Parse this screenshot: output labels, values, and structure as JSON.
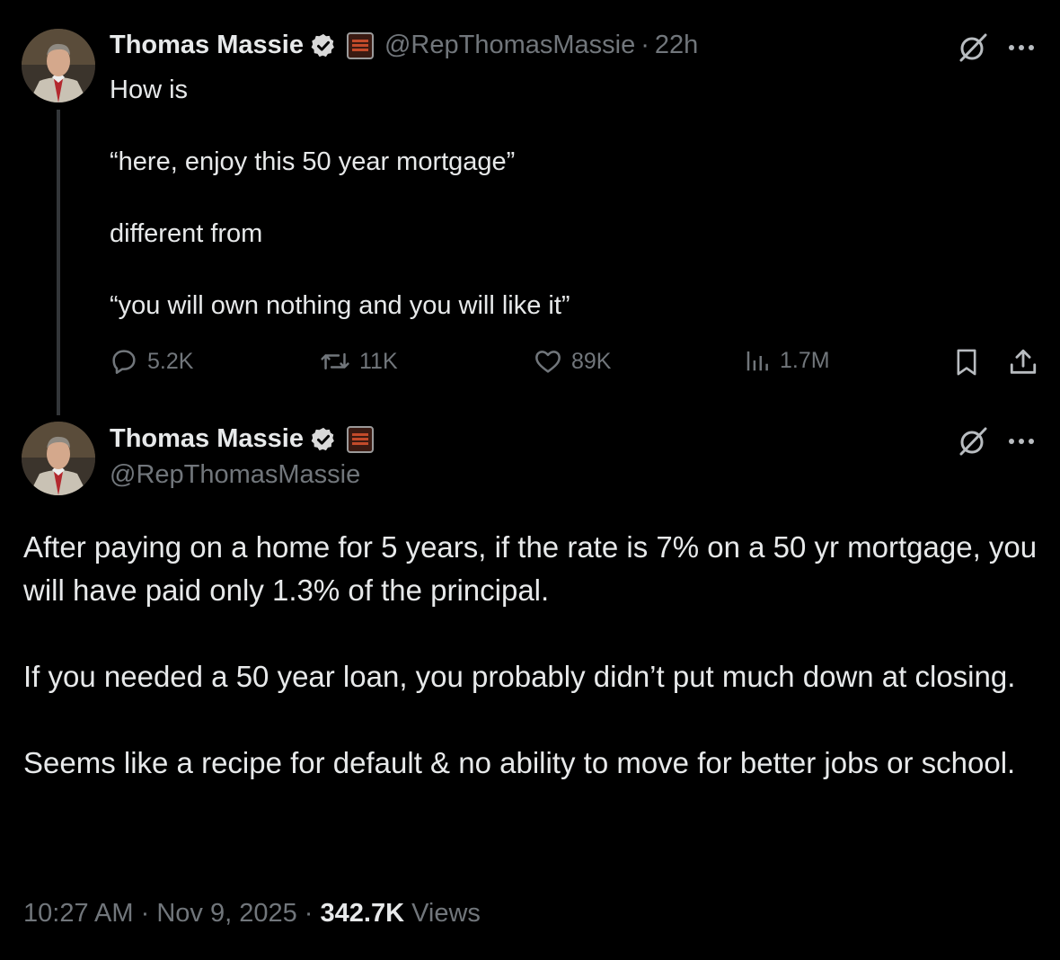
{
  "tweet1": {
    "author": "Thomas Massie",
    "handle": "@RepThomasMassie",
    "separator": "·",
    "time": "22h",
    "text": "How is\n\n“here, enjoy this 50 year mortgage”\n\ndifferent from\n\n“you will own nothing and you will like it”",
    "replies": "5.2K",
    "reposts": "11K",
    "likes": "89K",
    "views": "1.7M"
  },
  "tweet2": {
    "author": "Thomas Massie",
    "handle": "@RepThomasMassie",
    "paragraphs": [
      "After paying on a home for 5 years, if the rate is 7% on a 50 yr mortgage, you will have paid only 1.3% of the principal.",
      "If you needed a 50 year loan, you probably didn’t put much down at closing.",
      "Seems like a recipe for default & no ability to move for better jobs or school."
    ],
    "timestamp": "10:27 AM",
    "date": "Nov 9, 2025",
    "separator": "·",
    "views_count": "342.7K",
    "views_label": "Views"
  },
  "colors": {
    "background": "#000000",
    "text": "#e7e9ea",
    "muted": "#71767b",
    "thread_line": "#333639"
  },
  "icons": [
    "verified-badge-icon",
    "affiliate-badge-icon",
    "grok-icon",
    "more-icon",
    "reply-icon",
    "repost-icon",
    "like-icon",
    "views-icon",
    "bookmark-icon",
    "share-icon"
  ]
}
